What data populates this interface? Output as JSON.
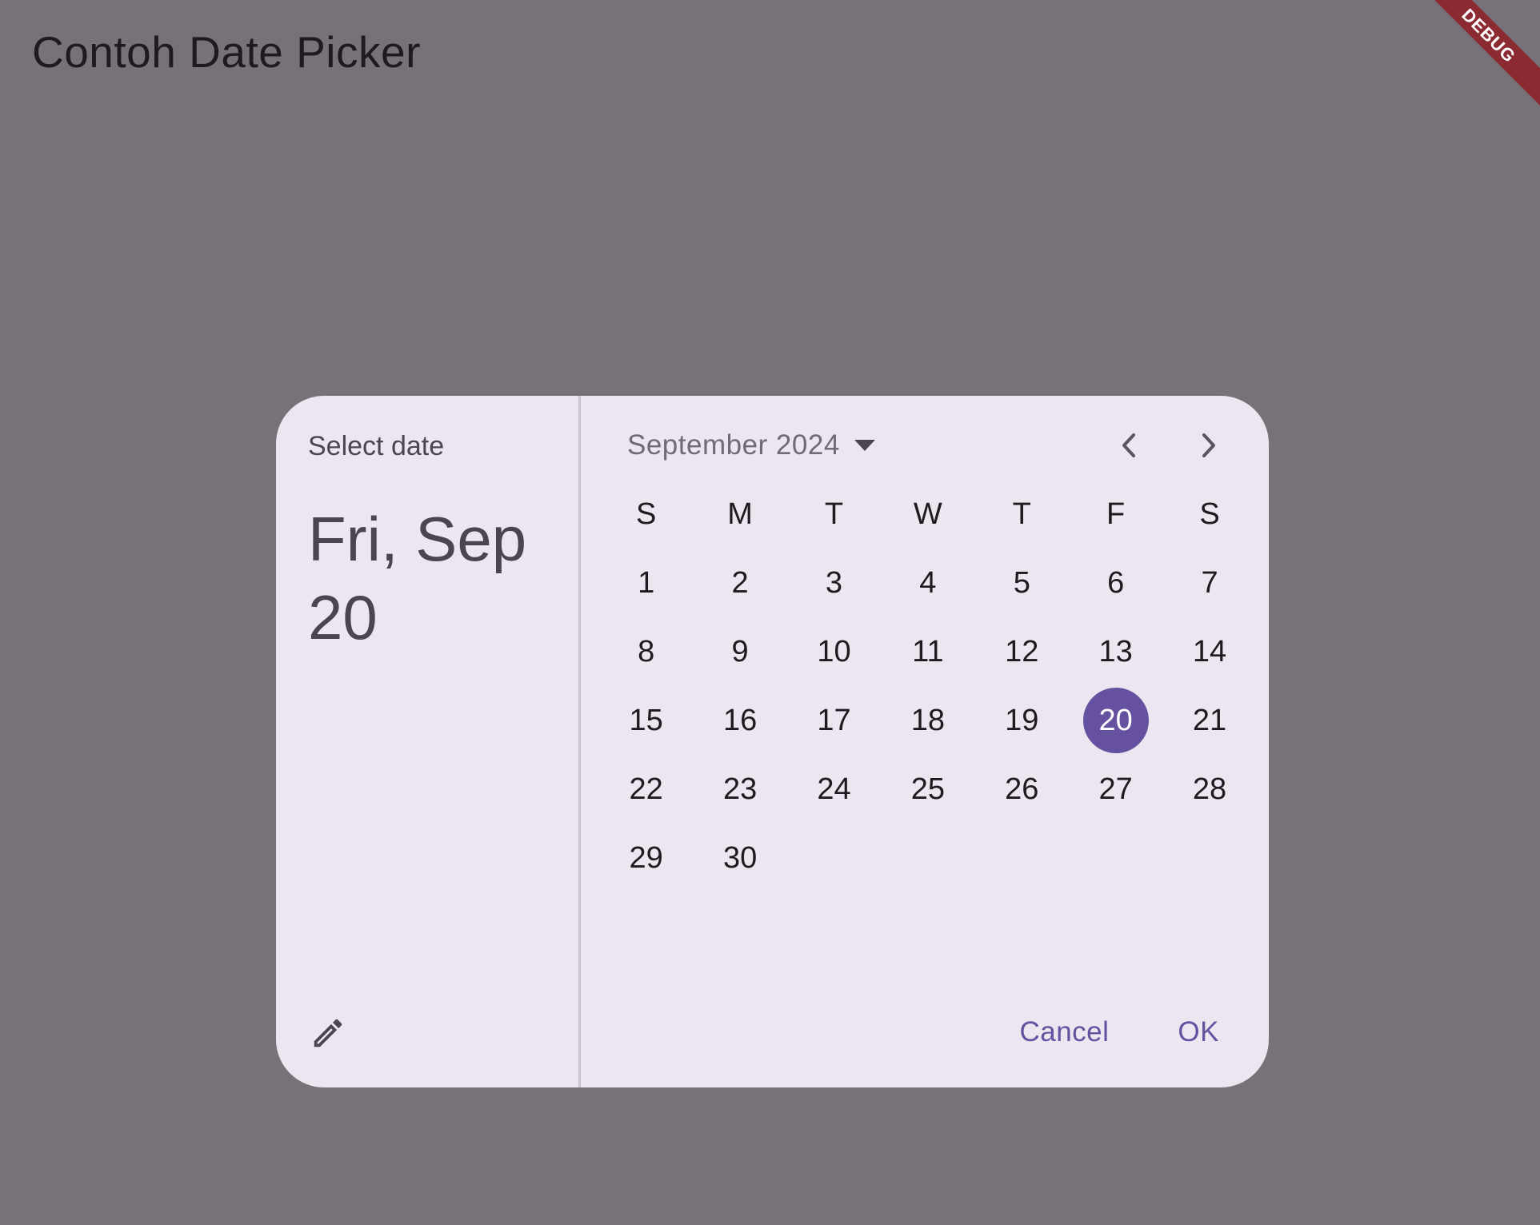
{
  "app": {
    "title": "Contoh Date Picker",
    "debug_label": "DEBUG"
  },
  "dialog": {
    "help_text": "Select date",
    "headline": "Fri, Sep 20",
    "month_label": "September 2024",
    "weekdays": [
      "S",
      "M",
      "T",
      "W",
      "T",
      "F",
      "S"
    ],
    "weeks": [
      [
        "1",
        "2",
        "3",
        "4",
        "5",
        "6",
        "7"
      ],
      [
        "8",
        "9",
        "10",
        "11",
        "12",
        "13",
        "14"
      ],
      [
        "15",
        "16",
        "17",
        "18",
        "19",
        "20",
        "21"
      ],
      [
        "22",
        "23",
        "24",
        "25",
        "26",
        "27",
        "28"
      ],
      [
        "29",
        "30",
        "",
        "",
        "",
        "",
        ""
      ]
    ],
    "selected_day": "20",
    "cancel_label": "Cancel",
    "ok_label": "OK",
    "icons": {
      "edit": "pencil-icon",
      "dropdown": "dropdown-arrow-icon",
      "prev": "chevron-left-icon",
      "next": "chevron-right-icon"
    },
    "colors": {
      "accent": "#65519f",
      "surface": "#ece6f0",
      "scrim": "#777277"
    }
  }
}
